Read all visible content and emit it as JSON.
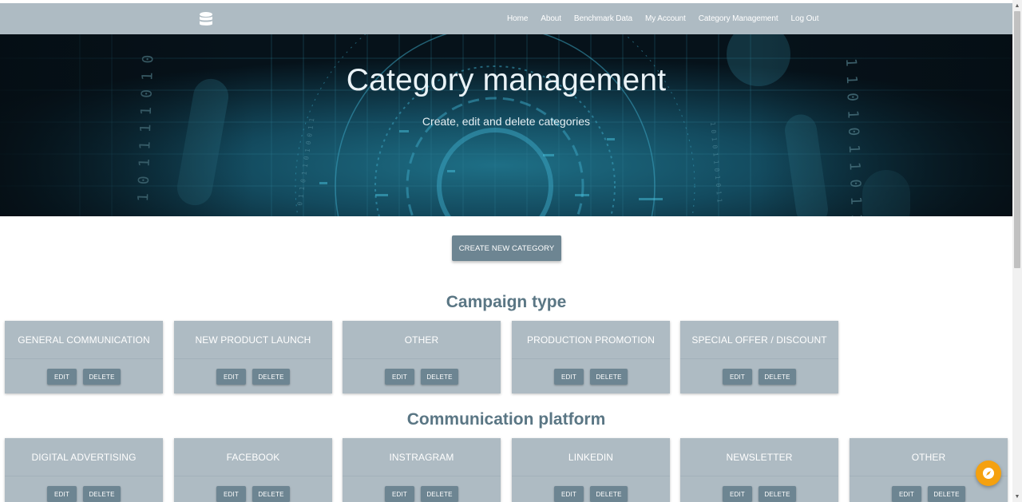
{
  "nav": {
    "logo_icon": "database-icon",
    "links": [
      "Home",
      "About",
      "Benchmark Data",
      "My Account",
      "Category Management",
      "Log Out"
    ]
  },
  "hero": {
    "title": "Category management",
    "subtitle": "Create, edit and delete categories"
  },
  "create_button": "CREATE NEW CATEGORY",
  "sections": [
    {
      "title": "Campaign type",
      "cards": [
        {
          "name": "GENERAL COMMUNICATION",
          "edit": "EDIT",
          "delete": "DELETE"
        },
        {
          "name": "NEW PRODUCT LAUNCH",
          "edit": "EDIT",
          "delete": "DELETE"
        },
        {
          "name": "OTHER",
          "edit": "EDIT",
          "delete": "DELETE"
        },
        {
          "name": "PRODUCTION PROMOTION",
          "edit": "EDIT",
          "delete": "DELETE"
        },
        {
          "name": "SPECIAL OFFER / DISCOUNT",
          "edit": "EDIT",
          "delete": "DELETE"
        }
      ]
    },
    {
      "title": "Communication platform",
      "cards": [
        {
          "name": "DIGITAL ADVERTISING",
          "edit": "EDIT",
          "delete": "DELETE"
        },
        {
          "name": "FACEBOOK",
          "edit": "EDIT",
          "delete": "DELETE"
        },
        {
          "name": "INSTRAGRAM",
          "edit": "EDIT",
          "delete": "DELETE"
        },
        {
          "name": "LINKEDIN",
          "edit": "EDIT",
          "delete": "DELETE"
        },
        {
          "name": "NEWSLETTER",
          "edit": "EDIT",
          "delete": "DELETE"
        },
        {
          "name": "OTHER",
          "edit": "EDIT",
          "delete": "DELETE"
        }
      ]
    }
  ],
  "fab_icon": "compass-icon",
  "colors": {
    "navbar": "#aebbc3",
    "card": "#aebbc3",
    "button": "#6d8592",
    "section_title": "#5a7684",
    "fab": "#f5a10f"
  }
}
